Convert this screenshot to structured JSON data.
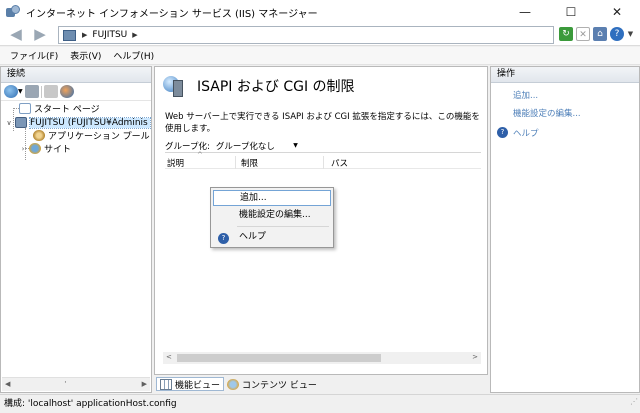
{
  "window": {
    "title": "インターネット インフォメーション サービス (IIS) マネージャー",
    "minimize_glyph": "—",
    "maximize_glyph": "☐",
    "close_glyph": "✕"
  },
  "address": {
    "back_glyph": "◀",
    "forward_glyph": "▶",
    "separator": "▶",
    "path": "FUJITSU",
    "trailing_separator": "▶"
  },
  "menu": {
    "items": [
      "ファイル(F)",
      "表示(V)",
      "ヘルプ(H)"
    ]
  },
  "connections": {
    "header": "接続",
    "tree": {
      "start_page": "スタート ページ",
      "server": "FUJITSU (FUJITSU¥Adminis",
      "app_pools": "アプリケーション プール",
      "sites": "サイト",
      "expanded_glyph": "∨",
      "collapsed_glyph": "›"
    },
    "scroll_left": "◀",
    "scroll_right": "▶",
    "scroll_mid": "·"
  },
  "feature": {
    "title": "ISAPI および CGI の制限",
    "description": "Web サーバー上で実行できる ISAPI および CGI 拡張を指定するには、この機能を使用します。",
    "group_by_label": "グループ化:",
    "group_by_value": "グループ化なし",
    "group_by_arrow": "▼",
    "columns": [
      "説明",
      "制限",
      "パス"
    ],
    "sort_arrow": "^",
    "scroll_left": "<",
    "scroll_right": ">"
  },
  "context_menu": {
    "items": [
      "追加...",
      "機能設定の編集...",
      "ヘルプ"
    ],
    "help_glyph": "?"
  },
  "view_tabs": {
    "features": "機能ビュー",
    "content": "コンテンツ ビュー"
  },
  "actions": {
    "header": "操作",
    "links": [
      "追加...",
      "機能設定の編集...",
      "ヘルプ"
    ],
    "help_glyph": "?"
  },
  "status": {
    "text": "構成: 'localhost' applicationHost.config"
  },
  "colors": {
    "link": "#4e7fb8",
    "selection": "#cde8ff"
  }
}
